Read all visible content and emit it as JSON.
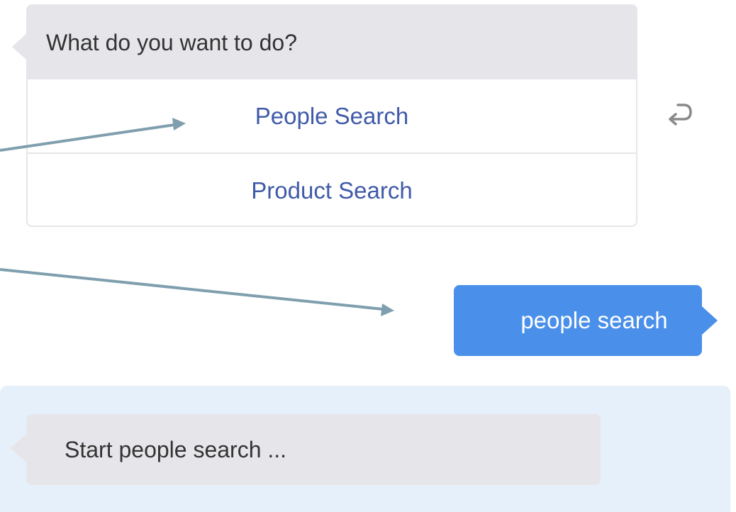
{
  "conversation": {
    "question": "What do you want to do?",
    "choices": [
      {
        "label": "People Search"
      },
      {
        "label": "Product Search"
      }
    ],
    "user_reply": "people search",
    "bot_reply": "Start people search ..."
  },
  "icons": {
    "undo": "return-arrow-icon"
  },
  "colors": {
    "bot_bubble": "#e6e6ea",
    "user_bubble": "#4a90ea",
    "choice_text": "#3f5aa8",
    "latest_panel": "#e6f0fa",
    "annotation_arrow": "#7f9fae"
  }
}
